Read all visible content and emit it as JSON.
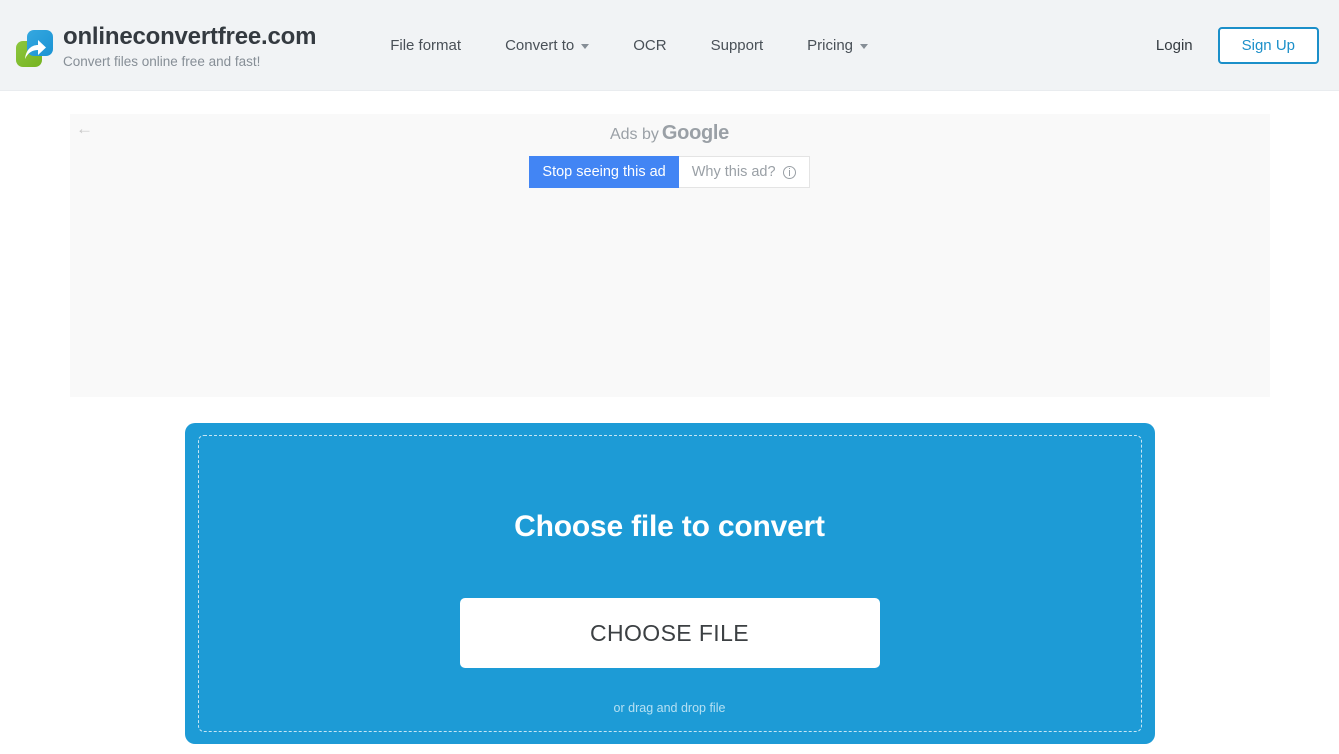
{
  "header": {
    "brand": {
      "title": "onlineconvertfree.com",
      "tagline": "Convert files online free and fast!",
      "logo_icon": "convert-arrow-logo"
    },
    "nav": [
      {
        "label": "File format",
        "has_caret": false
      },
      {
        "label": "Convert to",
        "has_caret": true
      },
      {
        "label": "OCR",
        "has_caret": false
      },
      {
        "label": "Support",
        "has_caret": false
      },
      {
        "label": "Pricing",
        "has_caret": true
      }
    ],
    "login_label": "Login",
    "signup_label": "Sign Up",
    "background_color": "#f1f3f5",
    "accent_color": "#1b8fc9"
  },
  "ad": {
    "back_arrow_icon": "←",
    "ads_by_prefix": "Ads by",
    "ads_by_brand": "Google",
    "stop_ad_label": "Stop seeing this ad",
    "why_ad_label": "Why this ad?",
    "why_ad_icon": "info-circle-icon",
    "stop_ad_color": "#4285f4",
    "panel_color": "#f9f9f9"
  },
  "dropzone": {
    "title": "Choose file to convert",
    "button_label": "CHOOSE FILE",
    "hint": "or drag and drop file",
    "background_color": "#1d9bd6",
    "hint_color": "#b5e0f3"
  }
}
